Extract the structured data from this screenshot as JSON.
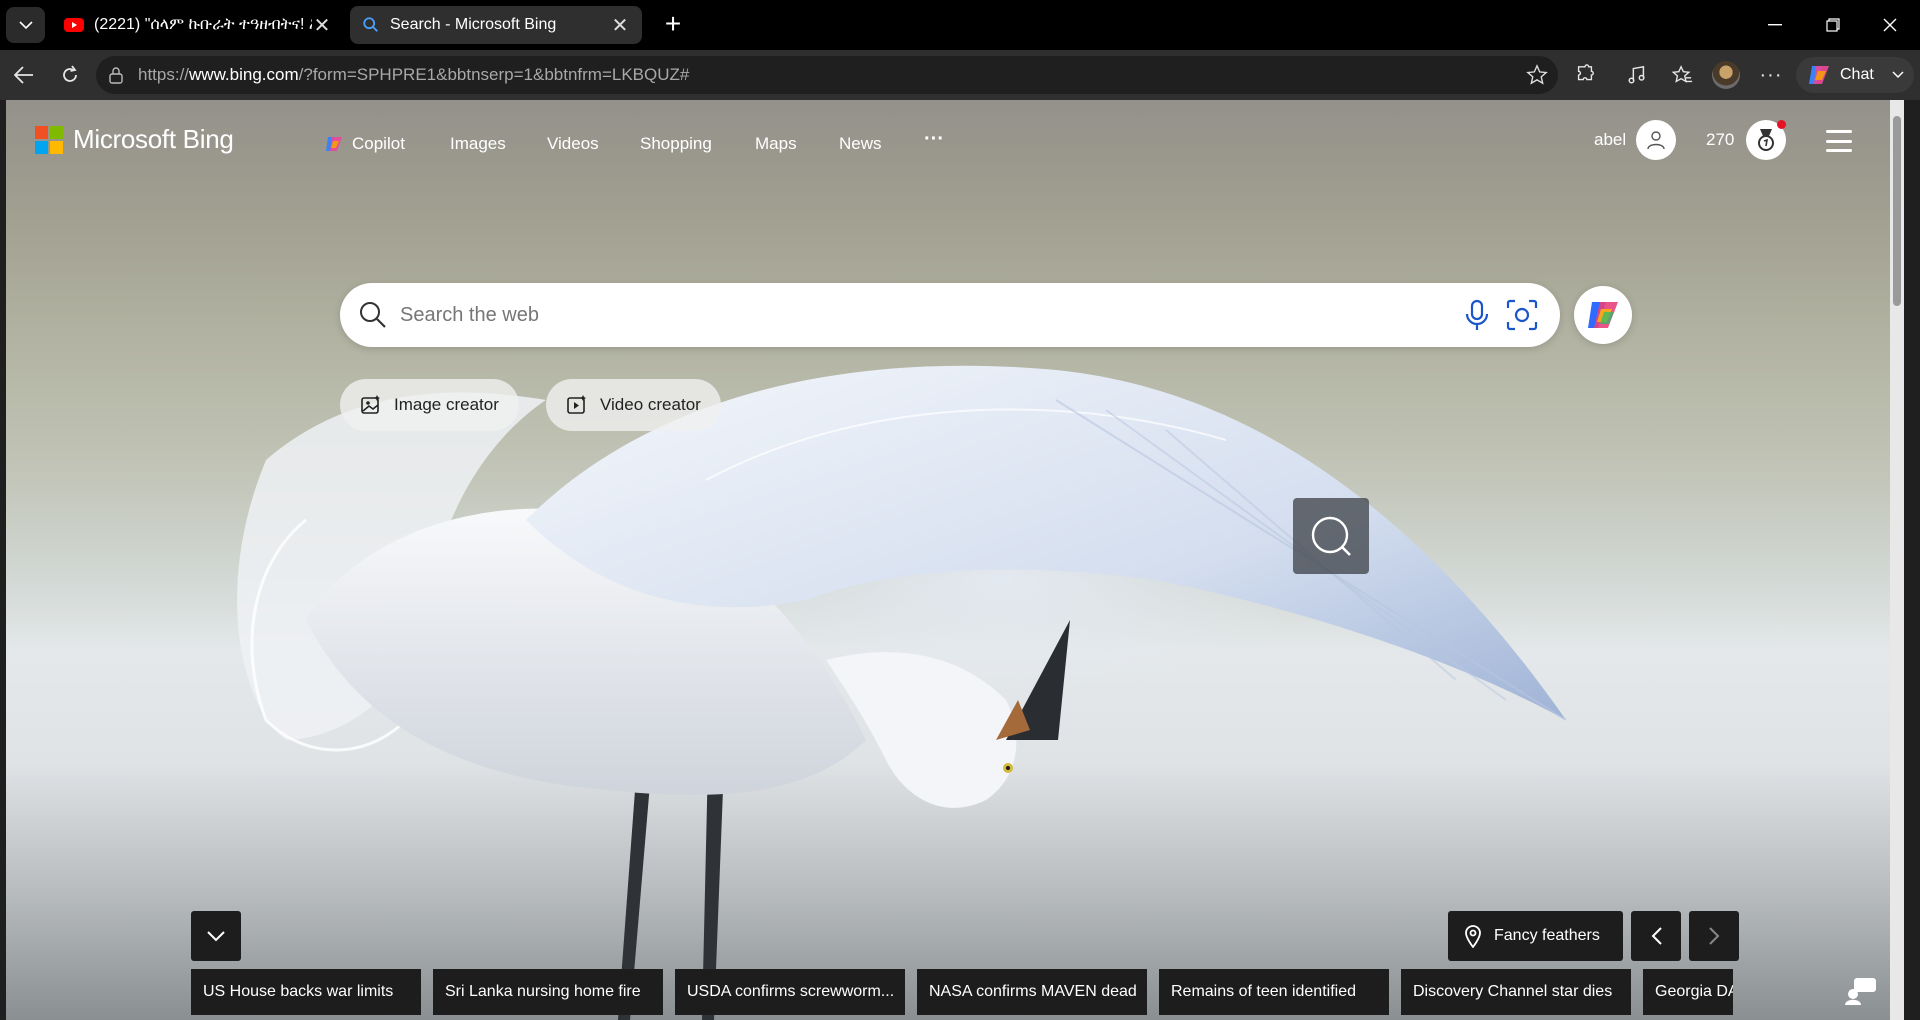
{
  "browser": {
    "tabs": [
      {
        "title": "(2221) \"ሰላም ኩቡራት ተዓዘብትና! እብ",
        "favicon": "youtube-icon",
        "active": false
      },
      {
        "title": "Search - Microsoft Bing",
        "favicon": "search-icon",
        "active": true
      }
    ],
    "url_prefix": "https://",
    "url_host": "www.bing.com",
    "url_rest": "/?form=SPHPRE1&bbtnserp=1&bbtnfrm=LKBQUZ#",
    "chat_label": "Chat"
  },
  "header": {
    "brand": "Microsoft Bing",
    "nav": [
      "Copilot",
      "Images",
      "Videos",
      "Shopping",
      "Maps",
      "News"
    ],
    "more": "···",
    "username": "abel",
    "points": "270"
  },
  "search": {
    "placeholder": "Search the web"
  },
  "creators": {
    "image": "Image creator",
    "video": "Video creator"
  },
  "image_info": {
    "location_label": "Fancy feathers"
  },
  "news": [
    "US House backs war limits",
    "Sri Lanka nursing home fire",
    "USDA confirms screwworm...",
    "NASA confirms MAVEN dead",
    "Remains of teen identified",
    "Discovery Channel star dies",
    "Georgia DA"
  ],
  "colors": {
    "ms_red": "#f25022",
    "ms_green": "#7fba00",
    "ms_blue": "#00a4ef",
    "ms_yellow": "#ffb900",
    "dark_tile": "#1d1d1d"
  }
}
